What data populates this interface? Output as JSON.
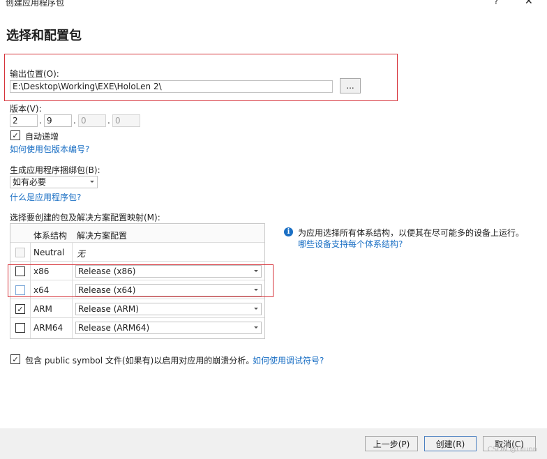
{
  "window": {
    "title": "创建应用程序包",
    "help_glyph": "?",
    "close_glyph": "✕"
  },
  "heading": "选择和配置包",
  "output": {
    "label": "输出位置(O):",
    "path": "E:\\Desktop\\Working\\EXE\\HoloLen 2\\",
    "browse_label": "..."
  },
  "version": {
    "label": "版本(V):",
    "parts": [
      "2",
      "9",
      "0",
      "0"
    ],
    "auto_increment_label": "自动递增",
    "auto_increment_checked": true,
    "help_link": "如何使用包版本编号?"
  },
  "bundle": {
    "label": "生成应用程序捆绑包(B):",
    "selected": "如有必要",
    "help_link": "什么是应用程序包?"
  },
  "mapping": {
    "label": "选择要创建的包及解决方案配置映射(M):",
    "headers": {
      "arch": "体系结构",
      "config": "解决方案配置"
    },
    "rows": [
      {
        "arch": "Neutral",
        "config": "无",
        "checked": false
      },
      {
        "arch": "x86",
        "config": "Release (x86)",
        "checked": false
      },
      {
        "arch": "x64",
        "config": "Release (x64)",
        "checked": false
      },
      {
        "arch": "ARM",
        "config": "Release (ARM)",
        "checked": true
      },
      {
        "arch": "ARM64",
        "config": "Release (ARM64)",
        "checked": false
      }
    ]
  },
  "info": {
    "text": "为应用选择所有体系结构，以便其在尽可能多的设备上运行。",
    "link": "哪些设备支持每个体系结构?"
  },
  "symbols": {
    "checked": true,
    "text": "包含 public symbol 文件(如果有)以启用对应用的崩溃分析。",
    "link": "如何使用调试符号?"
  },
  "footer": {
    "back": "上一步(P)",
    "create": "创建(R)",
    "cancel": "取消(C)"
  },
  "watermark": "CSDN @Glunn",
  "check_glyph": "✓",
  "colors": {
    "link": "#1a6fc4",
    "highlight_box": "#d6333a"
  }
}
